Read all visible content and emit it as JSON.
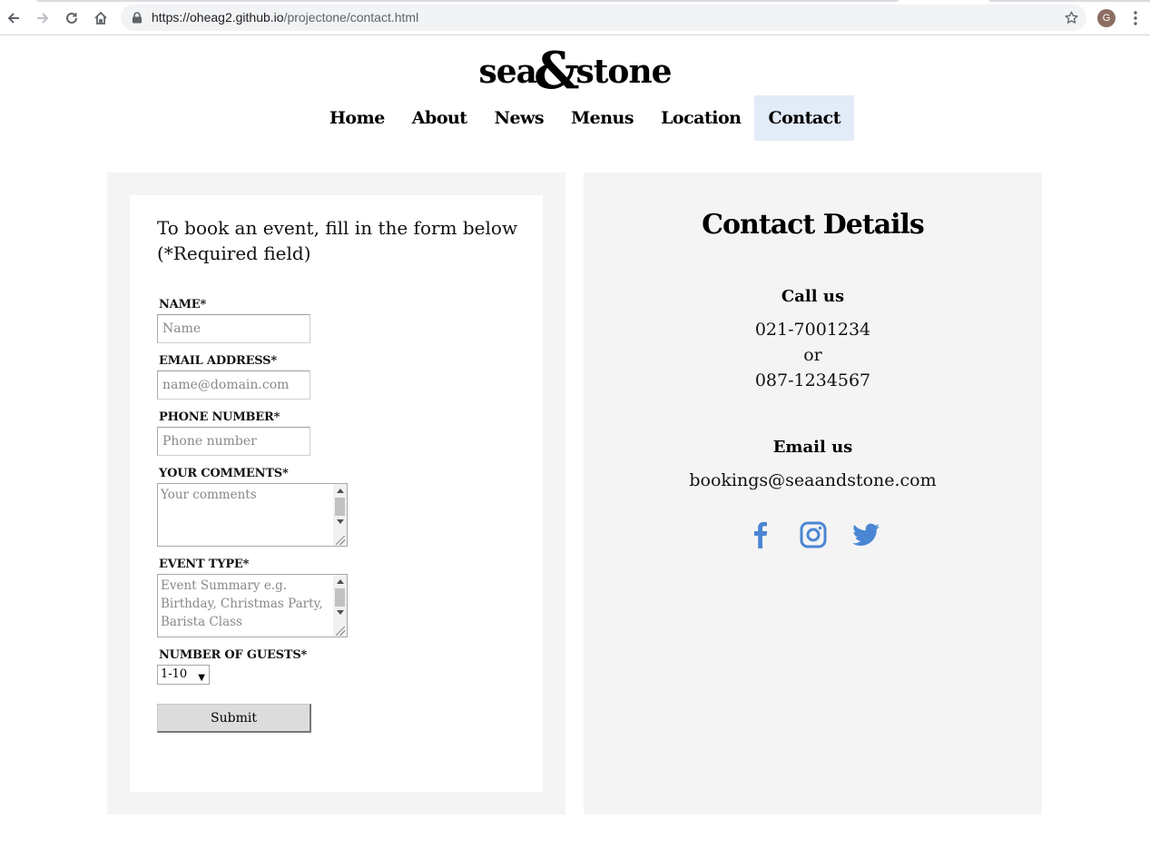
{
  "browser": {
    "url_host": "https://oheag2.github.io",
    "url_path": "/projectone/contact.html",
    "profile_initial": "G"
  },
  "site": {
    "logo_left": "sea",
    "logo_amp": "&",
    "logo_right": "stone",
    "nav": [
      {
        "label": "Home",
        "active": false
      },
      {
        "label": "About",
        "active": false
      },
      {
        "label": "News",
        "active": false
      },
      {
        "label": "Menus",
        "active": false
      },
      {
        "label": "Location",
        "active": false
      },
      {
        "label": "Contact",
        "active": true
      }
    ],
    "active_nav_color": "#e2ebf8"
  },
  "form": {
    "intro": "To book an event, fill in the form below (*Required field)",
    "name_label": "NAME*",
    "name_placeholder": "Name",
    "email_label": "EMAIL ADDRESS*",
    "email_placeholder": "name@domain.com",
    "phone_label": "PHONE NUMBER*",
    "phone_placeholder": "Phone number",
    "comments_label": "YOUR COMMENTS*",
    "comments_placeholder": "Your comments",
    "event_label": "EVENT TYPE*",
    "event_placeholder": "Event Summary e.g. Birthday, Christmas Party, Barista Class",
    "guests_label": "NUMBER OF GUESTS*",
    "guests_value": "1-10",
    "submit_label": "Submit"
  },
  "contact": {
    "title": "Contact Details",
    "call_heading": "Call us",
    "phone1": "021-7001234",
    "or_text": "or",
    "phone2": "087-1234567",
    "email_heading": "Email us",
    "email": "bookings@seaandstone.com",
    "social_icons": [
      "facebook-icon",
      "instagram-icon",
      "twitter-icon"
    ],
    "social_color": "#4a86d4"
  }
}
